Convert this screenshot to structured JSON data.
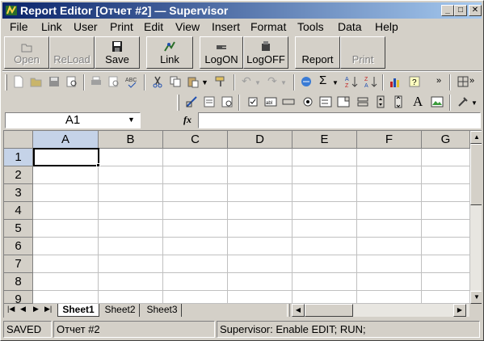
{
  "window": {
    "title": "Report Editor [Отчет #2] — Supervisor"
  },
  "menu": [
    "File",
    "Link",
    "User",
    "Print",
    "Edit",
    "View",
    "Insert",
    "Format",
    "Tools",
    "Data",
    "Help"
  ],
  "app_toolbar": {
    "open": "Open",
    "reload": "ReLoad",
    "save": "Save",
    "link": "Link",
    "logon": "LogON",
    "logoff": "LogOFF",
    "report": "Report",
    "print": "Print"
  },
  "formula_bar": {
    "cell_ref": "A1",
    "fx": "fx",
    "value": ""
  },
  "grid": {
    "columns": [
      "A",
      "B",
      "C",
      "D",
      "E",
      "F",
      "G"
    ],
    "rows": [
      "1",
      "2",
      "3",
      "4",
      "5",
      "6",
      "7",
      "8",
      "9"
    ],
    "selected_cell": "A1"
  },
  "sheets": {
    "tabs": [
      "Sheet1",
      "Sheet2",
      "Sheet3"
    ],
    "active": "Sheet1"
  },
  "status": {
    "state": "SAVED",
    "document": "Отчет #2",
    "message": "Supervisor: Enable EDIT; RUN;"
  },
  "colors": {
    "title_start": "#0a246a",
    "title_end": "#a6caf0",
    "face": "#d4d0c8",
    "selection": "#000000"
  }
}
